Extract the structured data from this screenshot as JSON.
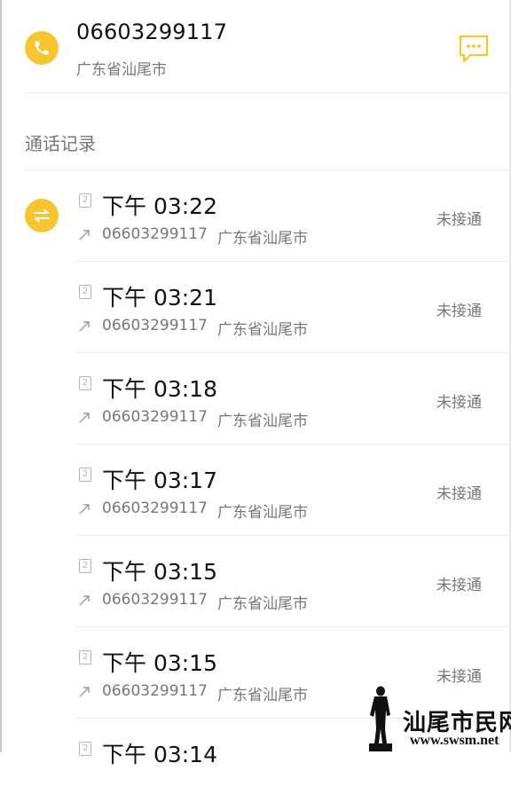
{
  "contact": {
    "number": "06603299117",
    "location": "广东省汕尾市"
  },
  "icons": {
    "call": "phone-icon",
    "sms": "message-icon",
    "group": "swap-arrows-icon",
    "sim": "sim-2-icon",
    "direction": "outgoing-arrow-icon"
  },
  "colors": {
    "accent": "#f7c531",
    "secondary_text": "#777777",
    "divider": "#ececec"
  },
  "section": {
    "title": "通话记录"
  },
  "calls": [
    {
      "sim": "2",
      "time": "下午 03:22",
      "number": "06603299117",
      "location": "广东省汕尾市",
      "status": "未接通"
    },
    {
      "sim": "2",
      "time": "下午 03:21",
      "number": "06603299117",
      "location": "广东省汕尾市",
      "status": "未接通"
    },
    {
      "sim": "2",
      "time": "下午 03:18",
      "number": "06603299117",
      "location": "广东省汕尾市",
      "status": "未接通"
    },
    {
      "sim": "2",
      "time": "下午 03:17",
      "number": "06603299117",
      "location": "广东省汕尾市",
      "status": "未接通"
    },
    {
      "sim": "2",
      "time": "下午 03:15",
      "number": "06603299117",
      "location": "广东省汕尾市",
      "status": "未接通"
    },
    {
      "sim": "2",
      "time": "下午 03:15",
      "number": "06603299117",
      "location": "广东省汕尾市",
      "status": "未接通"
    },
    {
      "sim": "2",
      "time": "下午 03:14",
      "number": "",
      "location": "",
      "status": ""
    }
  ],
  "watermark": {
    "title": "汕尾市民网",
    "url": "www.swsm.net"
  }
}
